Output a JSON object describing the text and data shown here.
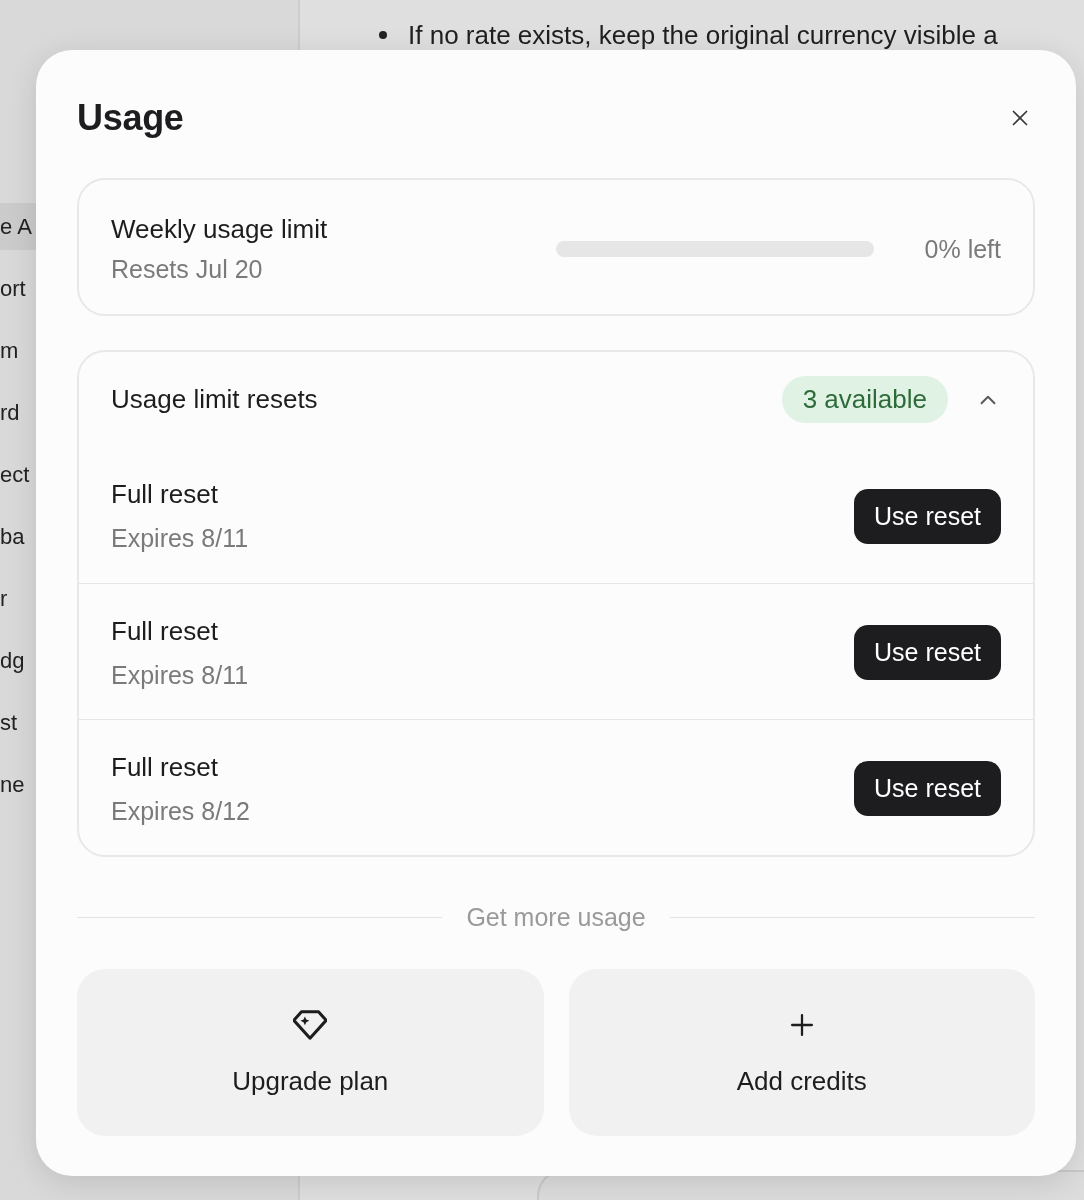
{
  "sidebar": {
    "items": [
      {
        "label": "e A",
        "selected": true
      },
      {
        "label": "ort",
        "selected": false
      },
      {
        "label": "m",
        "selected": false
      },
      {
        "label": "rd",
        "selected": false
      },
      {
        "label": "ect",
        "selected": false
      },
      {
        "label": "ba",
        "selected": false
      },
      {
        "label": "r",
        "selected": false
      },
      {
        "label": "dg",
        "selected": false
      },
      {
        "label": "st",
        "selected": false
      },
      {
        "label": "ne",
        "selected": false
      }
    ]
  },
  "document": {
    "bullet": "If no rate exists, keep the original currency visible a"
  },
  "dialog": {
    "title": "Usage",
    "weekly_limit": {
      "title": "Weekly usage limit",
      "subtitle": "Resets Jul 20",
      "level": 0,
      "reading": "0% left"
    },
    "resets": {
      "title": "Usage limit resets",
      "badge": "3 available",
      "expanded": true,
      "items": [
        {
          "title": "Full reset",
          "expires": "Expires 8/11",
          "button": "Use reset"
        },
        {
          "title": "Full reset",
          "expires": "Expires 8/11",
          "button": "Use reset"
        },
        {
          "title": "Full reset",
          "expires": "Expires 8/12",
          "button": "Use reset"
        }
      ]
    },
    "more_usage": {
      "label": "Get more usage",
      "options": [
        {
          "kind": "upgrade",
          "label": "Upgrade plan"
        },
        {
          "kind": "credits",
          "label": "Add credits"
        }
      ]
    }
  }
}
